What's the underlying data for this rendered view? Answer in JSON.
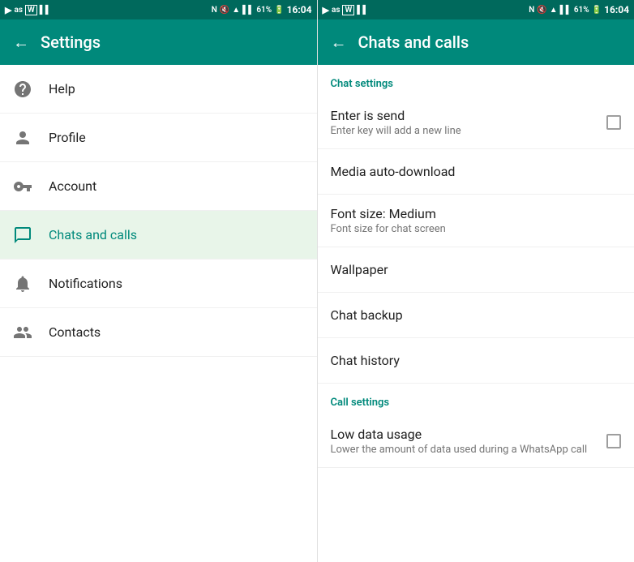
{
  "left_panel": {
    "status_bar": {
      "time": "16:04",
      "battery": "61%"
    },
    "header": {
      "back_label": "←",
      "title": "Settings"
    },
    "menu_items": [
      {
        "id": "help",
        "label": "Help",
        "icon": "help"
      },
      {
        "id": "profile",
        "label": "Profile",
        "icon": "person"
      },
      {
        "id": "account",
        "label": "Account",
        "icon": "key"
      },
      {
        "id": "chats",
        "label": "Chats and calls",
        "icon": "chat",
        "active": true
      },
      {
        "id": "notifications",
        "label": "Notifications",
        "icon": "bell"
      },
      {
        "id": "contacts",
        "label": "Contacts",
        "icon": "people"
      }
    ]
  },
  "right_panel": {
    "status_bar": {
      "time": "16:04",
      "battery": "61%"
    },
    "header": {
      "back_label": "←",
      "title": "Chats and calls"
    },
    "sections": [
      {
        "id": "chat_settings",
        "label": "Chat settings",
        "items": [
          {
            "id": "enter_send",
            "title": "Enter is send",
            "subtitle": "Enter key will add a new line",
            "has_checkbox": true,
            "checked": false
          },
          {
            "id": "media_auto_download",
            "title": "Media auto-download",
            "subtitle": "",
            "has_checkbox": false
          },
          {
            "id": "font_size",
            "title": "Font size: Medium",
            "subtitle": "Font size for chat screen",
            "has_checkbox": false
          },
          {
            "id": "wallpaper",
            "title": "Wallpaper",
            "subtitle": "",
            "has_checkbox": false
          },
          {
            "id": "chat_backup",
            "title": "Chat backup",
            "subtitle": "",
            "has_checkbox": false
          },
          {
            "id": "chat_history",
            "title": "Chat history",
            "subtitle": "",
            "has_checkbox": false
          }
        ]
      },
      {
        "id": "call_settings",
        "label": "Call settings",
        "items": [
          {
            "id": "low_data",
            "title": "Low data usage",
            "subtitle": "Lower the amount of data used during a WhatsApp call",
            "has_checkbox": true,
            "checked": false
          }
        ]
      }
    ]
  }
}
